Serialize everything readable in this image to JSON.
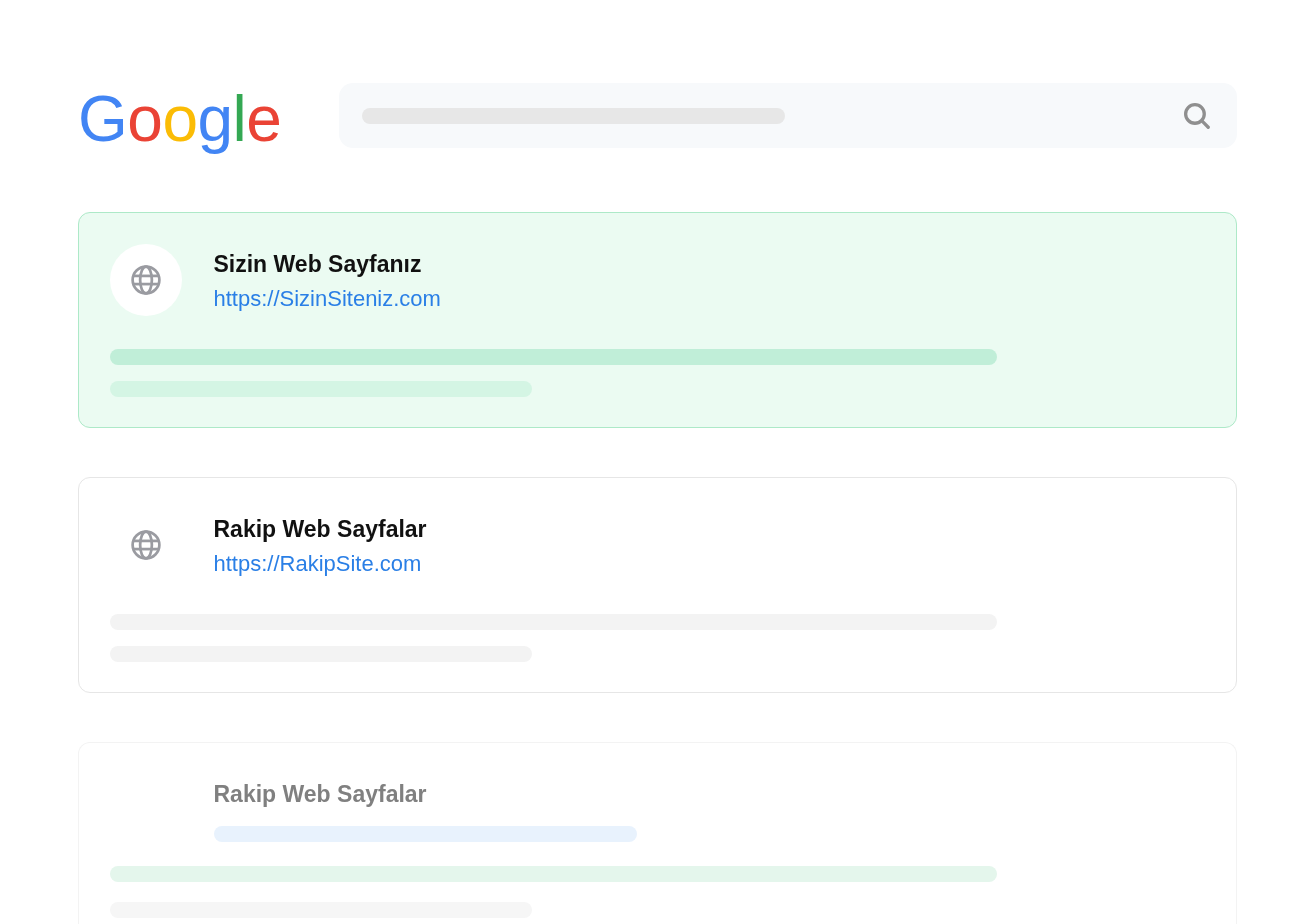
{
  "logo": {
    "text": "Google"
  },
  "results": [
    {
      "kind": "highlighted",
      "title": "Sizin Web Sayfanız",
      "url": "https://SizinSiteniz.com"
    },
    {
      "kind": "plain",
      "title": "Rakip Web Sayfalar",
      "url": "https://RakipSite.com"
    },
    {
      "kind": "faded",
      "title": "Rakip Web Sayfalar"
    }
  ]
}
